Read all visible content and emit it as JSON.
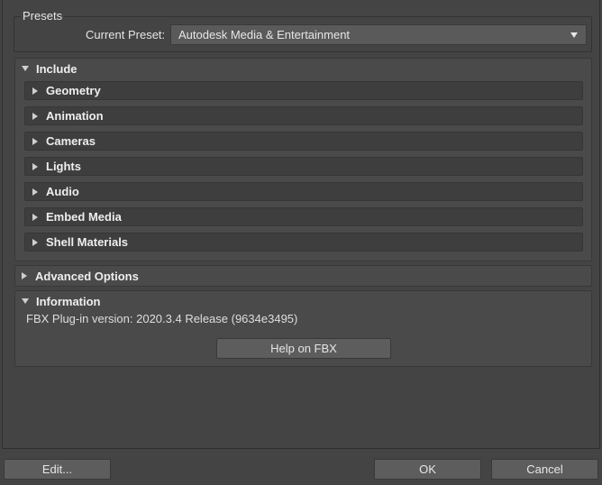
{
  "presets": {
    "group_title": "Presets",
    "current_label": "Current Preset:",
    "current_value": "Autodesk Media & Entertainment"
  },
  "include": {
    "title": "Include",
    "items": [
      {
        "label": "Geometry"
      },
      {
        "label": "Animation"
      },
      {
        "label": "Cameras"
      },
      {
        "label": "Lights"
      },
      {
        "label": "Audio"
      },
      {
        "label": "Embed Media"
      },
      {
        "label": "Shell Materials"
      }
    ]
  },
  "advanced": {
    "title": "Advanced Options"
  },
  "information": {
    "title": "Information",
    "version_text": "FBX Plug-in version: 2020.3.4 Release (9634e3495)",
    "help_button": "Help on FBX"
  },
  "footer": {
    "edit_button": "Edit...",
    "ok_button": "OK",
    "cancel_button": "Cancel"
  }
}
